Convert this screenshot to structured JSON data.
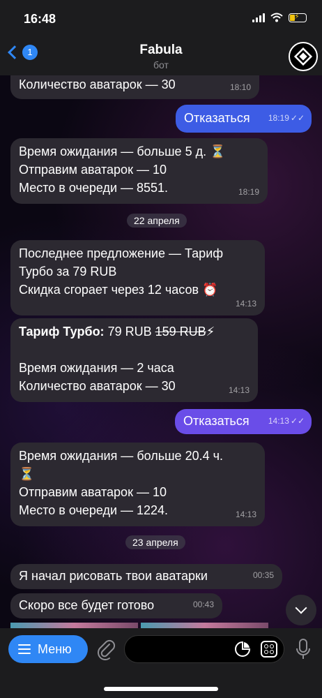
{
  "status": {
    "time": "16:48"
  },
  "header": {
    "back_count": "1",
    "title": "Fabula",
    "subtitle": "бот"
  },
  "messages": [
    {
      "lines": [
        "Количество аватарок —  30"
      ],
      "time": "18:10"
    },
    {
      "text": "Отказаться",
      "time": "18:19"
    },
    {
      "lines": [
        "Время ожидания — больше 5 д. ⏳",
        "Отправим аватарок — 10",
        "Место в очереди — 8551."
      ],
      "time": "18:19"
    },
    {
      "date": "22 апреля"
    },
    {
      "lines": [
        "Последнее предложение — Тариф",
        "Турбо за 79 RUB",
        "Скидка сгорает через 12 часов ⏰"
      ],
      "time": "14:13"
    },
    {
      "title": "Тариф Турбо:",
      "price": " 79 RUB ",
      "old_price": "159 RUB",
      "emoji": "⚡",
      "lines": [
        "Время ожидания — 2 часа",
        "Количество аватарок —  30"
      ],
      "time": "14:13"
    },
    {
      "text": "Отказаться",
      "time": "14:13"
    },
    {
      "lines": [
        "Время ожидания — больше 20.4 ч.",
        "⏳",
        "Отправим аватарок — 10",
        "Место в очереди — 1224."
      ],
      "time": "14:13"
    },
    {
      "date": "23 апреля"
    },
    {
      "text": "Я начал рисовать твои аватарки",
      "time": "00:35"
    },
    {
      "text": "Скоро все будет готово",
      "time": "00:43"
    }
  ],
  "input": {
    "menu_label": "Меню"
  },
  "icons": [
    "back-chevron-icon",
    "bot-logo-icon",
    "paperclip-icon",
    "sticker-icon",
    "bot-commands-icon",
    "microphone-icon",
    "chevron-down-icon",
    "read-ticks-icon"
  ],
  "colors": {
    "accent": "#2f87f5",
    "outgoing": "#6a4de8",
    "incoming": "#2c2931"
  }
}
